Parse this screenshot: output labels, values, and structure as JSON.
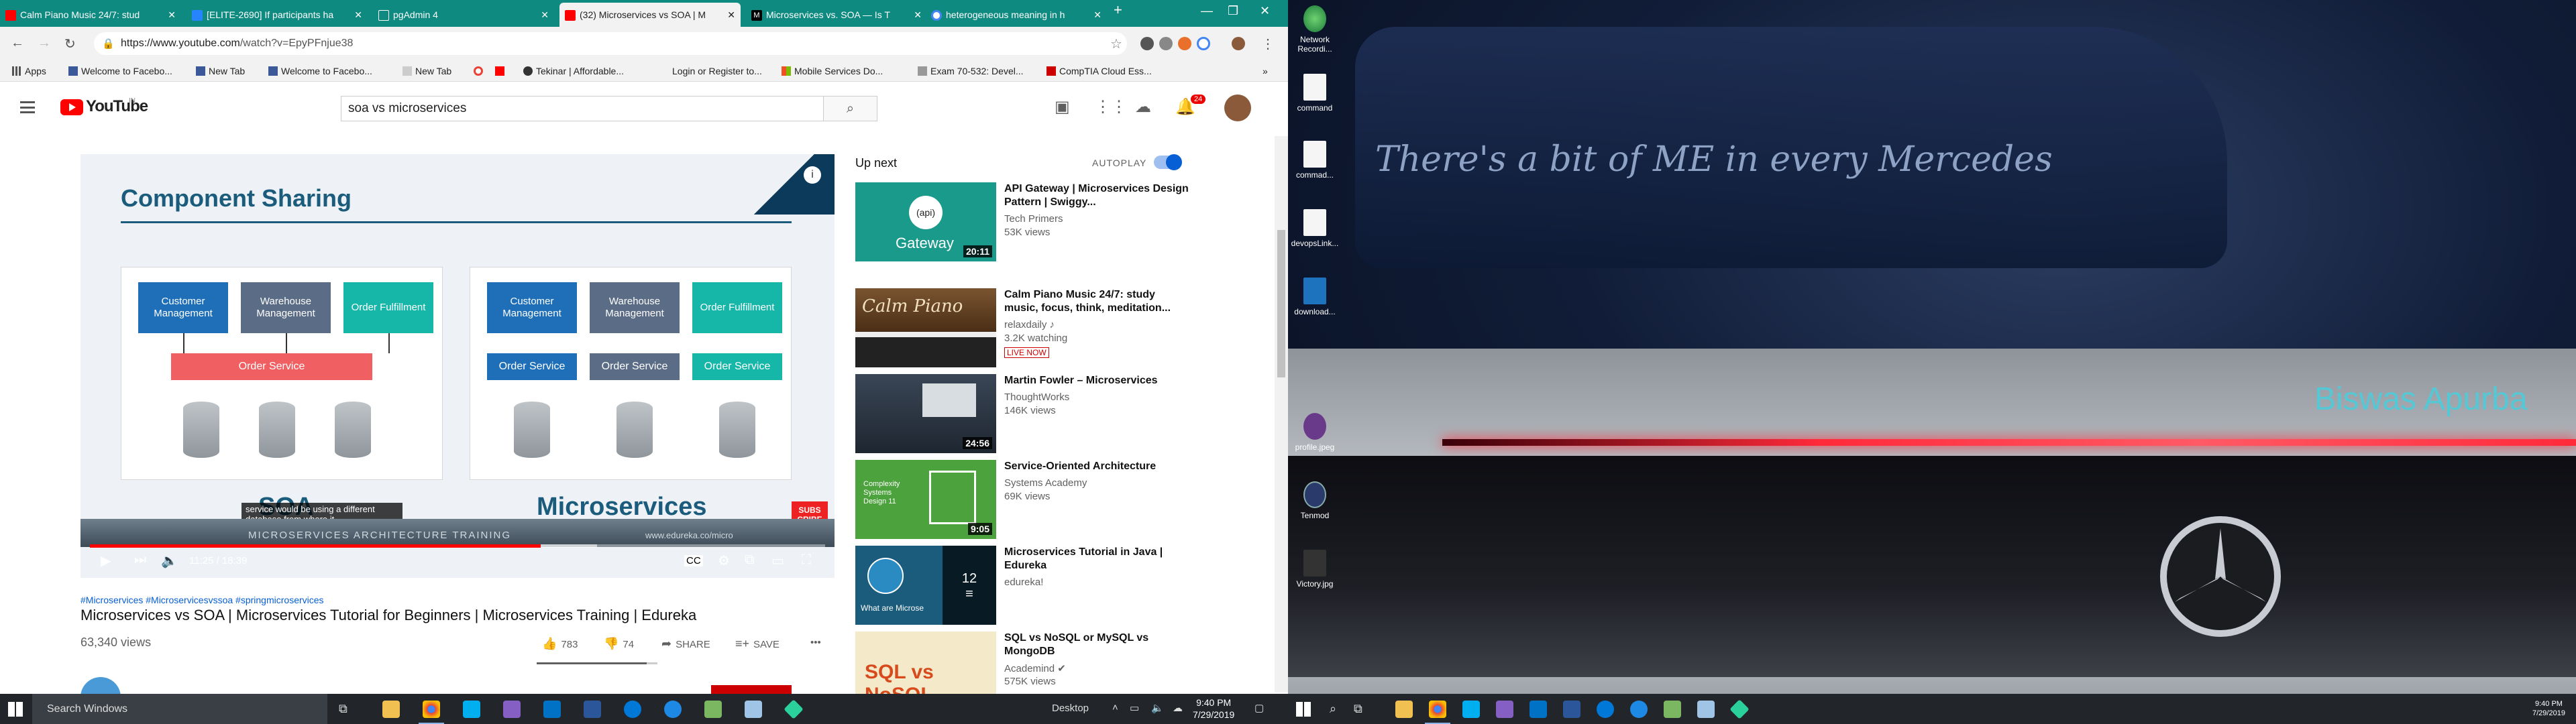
{
  "browser": {
    "tabs": [
      {
        "title": "Calm Piano Music 24/7: stud",
        "fav_color": "#ff0000"
      },
      {
        "title": "[ELITE-2690] If participants ha",
        "fav_color": "#2684ff"
      },
      {
        "title": "pgAdmin 4",
        "fav_color": "#0e8a80"
      },
      {
        "title": "(32) Microservices vs SOA | M",
        "fav_color": "#ff0000"
      },
      {
        "title": "Microservices vs. SOA — Is T",
        "fav_color": "#000000"
      },
      {
        "title": "heterogeneous meaning in h",
        "fav_color": "#4285f4"
      }
    ],
    "url_host": "https://www.youtube.com",
    "url_path": "/watch?v=EpyPFnjue38",
    "bookmarks": [
      "Apps",
      "Welcome to Facebo...",
      "New Tab",
      "Welcome to Facebo...",
      "New Tab",
      "",
      "",
      "Tekinar | Affordable...",
      "Login or Register to...",
      "Mobile Services Do...",
      "Exam 70-532: Devel...",
      "CompTIA Cloud Ess..."
    ]
  },
  "youtube": {
    "search_query": "soa vs microservices",
    "notification_count": "24",
    "player": {
      "slide_title": "Component Sharing",
      "soa_boxes": [
        "Customer Management",
        "Warehouse Management",
        "Order Fulfillment"
      ],
      "soa_order": "Order Service",
      "ms_boxes": [
        "Customer Management",
        "Warehouse Management",
        "Order Fulfillment"
      ],
      "ms_orders": [
        "Order Service",
        "Order Service",
        "Order Service"
      ],
      "label_left": "SOA",
      "label_right": "Microservices",
      "caption": "service would be using a different database from where it",
      "subscribe": "SUBS CRIBE",
      "banner": "MICROSERVICES ARCHITECTURE TRAINING",
      "watermark": "www.edureka.co/micro",
      "time": "11:25 / 18:39",
      "progress": 0.613,
      "buffered": 0.69
    },
    "hashtags": "#Microservices #Microservicesvssoa #springmicroservices",
    "title": "Microservices vs SOA | Microservices Tutorial for Beginners | Microservices Training | Edureka",
    "views": "63,340 views",
    "likes": "783",
    "dislikes": "74",
    "share_label": "SHARE",
    "save_label": "SAVE",
    "like_ratio": 0.91,
    "up_next_label": "Up next",
    "autoplay_label": "AUTOPLAY",
    "recommendations": [
      {
        "title": "API Gateway | Microservices Design Pattern | Swiggy...",
        "channel": "Tech Primers",
        "views": "53K views",
        "duration": "20:11",
        "thumb_text": "Gateway",
        "thumb_color": "#1a9a8a"
      },
      {
        "title": "Calm Piano Music 24/7: study music, focus, think, meditation...",
        "channel": "relaxdaily ♪",
        "views": "3.2K watching",
        "duration": "",
        "live": "LIVE NOW",
        "thumb_text": "Calm Piano",
        "thumb_color": "#6a4a2a"
      },
      {
        "title": "Martin Fowler – Microservices",
        "channel": "ThoughtWorks",
        "views": "146K views",
        "duration": "24:56",
        "thumb_text": "",
        "thumb_color": "#2c3a4a"
      },
      {
        "title": "Service-Oriented Architecture",
        "channel": "Systems Academy",
        "views": "69K views",
        "duration": "9:05",
        "thumb_text": "Complexity Systems Design 11",
        "thumb_color": "#4ca23c"
      },
      {
        "title": "Microservices Tutorial in Java | Edureka",
        "channel": "edureka!",
        "views": "",
        "duration": "",
        "playlist_count": "12",
        "thumb_text": "What are Microse",
        "thumb_color": "#1b5c7c"
      },
      {
        "title": "SQL vs NoSQL or MySQL vs MongoDB",
        "channel": "Academind ✔",
        "views": "575K views",
        "duration": "",
        "thumb_text": "SQL vs NoSQL",
        "thumb_color": "#f4b83a"
      }
    ]
  },
  "taskbar": {
    "search_placeholder": "Search Windows",
    "desktop_label": "Desktop",
    "time": "9:40 PM",
    "date": "7/29/2019"
  },
  "desktop2": {
    "slogan": "There's a bit of ME in every Mercedes",
    "nameplate": "Biswas Apurba",
    "icons": [
      "Network Recordi...",
      "command",
      "commad...",
      "devopsLink...",
      "download...",
      "profile.jpeg",
      "Tenmod",
      "Victory.jpg"
    ],
    "time": "9:40 PM",
    "date": "7/29/2019"
  }
}
